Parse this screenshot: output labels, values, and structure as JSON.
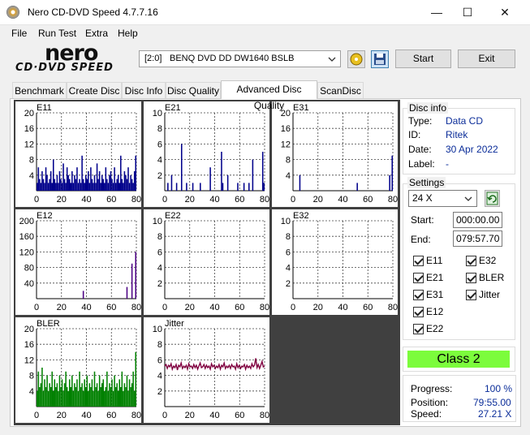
{
  "window": {
    "title": "Nero CD-DVD Speed 4.7.7.16",
    "controls": {
      "minimize": "—",
      "maximize": "☐",
      "close": "✕"
    }
  },
  "menu": [
    "File",
    "Run Test",
    "Extra",
    "Help"
  ],
  "toolbar": {
    "logo_main": "nero",
    "logo_sub": "CD·DVD SPEED",
    "drive_id": "[2:0]",
    "drive_name": "BENQ DVD DD DW1640 BSLB",
    "start_label": "Start",
    "exit_label": "Exit",
    "icons": [
      "eject-icon",
      "save-icon"
    ]
  },
  "tabs": [
    "Benchmark",
    "Create Disc",
    "Disc Info",
    "Disc Quality",
    "Advanced Disc Quality",
    "ScanDisc"
  ],
  "active_tab": "Advanced Disc Quality",
  "disc_info": {
    "title": "Disc info",
    "rows": [
      {
        "key": "Type:",
        "value": "Data CD"
      },
      {
        "key": "ID:",
        "value": "Ritek"
      },
      {
        "key": "Date:",
        "value": "30 Apr 2022"
      },
      {
        "key": "Label:",
        "value": "-"
      }
    ]
  },
  "settings": {
    "title": "Settings",
    "speed": "24 X",
    "start_label": "Start:",
    "start_value": "000:00.00",
    "end_label": "End:",
    "end_value": "079:57.70",
    "checkboxes_left": [
      "E11",
      "E21",
      "E31",
      "E12",
      "E22"
    ],
    "checkboxes_right": [
      "E32",
      "BLER",
      "Jitter"
    ]
  },
  "result": {
    "class_label": "Class 2",
    "class_color": "#7cfc3c"
  },
  "progress": {
    "rows": [
      {
        "key": "Progress:",
        "value": "100 %"
      },
      {
        "key": "Position:",
        "value": "79:55.00"
      },
      {
        "key": "Speed:",
        "value": "27.21 X"
      }
    ]
  },
  "chart_data": [
    {
      "type": "bar",
      "title": "E11",
      "ylim": [
        0,
        20
      ],
      "yticks": [
        "20",
        "16",
        "12",
        "8",
        "4"
      ],
      "xticks": [
        "0",
        "20",
        "40",
        "60",
        "80"
      ],
      "color": "#00008b",
      "values": [
        2,
        6,
        3,
        2,
        5,
        3,
        2,
        6,
        4,
        2,
        3,
        5,
        2,
        8,
        3,
        2,
        4,
        2,
        5,
        3,
        2,
        7,
        3,
        2,
        6,
        4,
        3,
        2,
        5,
        2,
        4,
        3,
        6,
        2,
        3,
        2,
        9,
        3,
        2,
        4,
        3,
        5,
        2,
        6,
        3,
        2,
        4,
        2,
        7,
        3,
        5,
        2,
        4,
        3,
        2,
        6,
        3,
        2,
        4,
        5,
        3,
        2,
        6,
        2,
        3,
        4,
        2,
        9,
        3,
        2,
        5,
        4,
        3,
        6,
        2,
        4,
        3,
        2,
        5,
        9
      ]
    },
    {
      "type": "bar",
      "title": "E21",
      "ylim": [
        0,
        10
      ],
      "yticks": [
        "10",
        "8",
        "6",
        "4",
        "2"
      ],
      "xticks": [
        "0",
        "20",
        "40",
        "60",
        "80"
      ],
      "color": "#00008b",
      "values": [
        0,
        0,
        1,
        0,
        0,
        2,
        0,
        0,
        0,
        1,
        0,
        0,
        0,
        6,
        0,
        0,
        0,
        1,
        0,
        0,
        0,
        0,
        1,
        0,
        0,
        0,
        0,
        0,
        1,
        0,
        0,
        0,
        0,
        0,
        0,
        0,
        3,
        0,
        0,
        0,
        0,
        0,
        0,
        0,
        0,
        5,
        1,
        0,
        0,
        0,
        2,
        0,
        0,
        0,
        0,
        0,
        0,
        0,
        1,
        0,
        0,
        0,
        0,
        1,
        0,
        0,
        0,
        1,
        0,
        0,
        4,
        0,
        0,
        0,
        0,
        0,
        0,
        0,
        5,
        1
      ]
    },
    {
      "type": "bar",
      "title": "E31",
      "ylim": [
        0,
        20
      ],
      "yticks": [
        "20",
        "16",
        "12",
        "8",
        "4"
      ],
      "xticks": [
        "0",
        "20",
        "40",
        "60",
        "80"
      ],
      "color": "#00008b",
      "values": [
        0,
        0,
        0,
        0,
        0,
        4,
        0,
        0,
        0,
        0,
        0,
        0,
        0,
        0,
        0,
        0,
        0,
        0,
        0,
        0,
        0,
        0,
        0,
        0,
        0,
        0,
        0,
        0,
        0,
        0,
        0,
        0,
        0,
        0,
        0,
        0,
        0,
        0,
        0,
        0,
        0,
        0,
        0,
        0,
        0,
        0,
        0,
        0,
        0,
        0,
        0,
        2,
        0,
        0,
        0,
        0,
        0,
        0,
        0,
        0,
        0,
        0,
        0,
        0,
        0,
        0,
        0,
        0,
        0,
        0,
        0,
        0,
        0,
        0,
        0,
        0,
        0,
        4,
        0,
        9
      ]
    },
    {
      "type": "bar",
      "title": "E12",
      "ylim": [
        0,
        200
      ],
      "yticks": [
        "200",
        "160",
        "120",
        "80",
        "40"
      ],
      "xticks": [
        "0",
        "20",
        "40",
        "60",
        "80"
      ],
      "color": "#4b0082",
      "values": [
        0,
        0,
        0,
        0,
        0,
        0,
        0,
        0,
        0,
        0,
        0,
        0,
        0,
        0,
        0,
        0,
        0,
        0,
        0,
        0,
        0,
        0,
        0,
        0,
        0,
        0,
        0,
        0,
        0,
        0,
        0,
        0,
        0,
        0,
        0,
        0,
        0,
        20,
        0,
        0,
        0,
        0,
        0,
        0,
        0,
        0,
        0,
        0,
        0,
        0,
        0,
        0,
        0,
        0,
        0,
        0,
        0,
        0,
        0,
        0,
        0,
        0,
        0,
        0,
        0,
        0,
        0,
        0,
        0,
        0,
        0,
        0,
        30,
        0,
        0,
        0,
        90,
        0,
        0,
        120
      ]
    },
    {
      "type": "bar",
      "title": "E22",
      "ylim": [
        0,
        10
      ],
      "yticks": [
        "10",
        "8",
        "6",
        "4",
        "2"
      ],
      "xticks": [
        "0",
        "20",
        "40",
        "60",
        "80"
      ],
      "color": "#00008b",
      "values": []
    },
    {
      "type": "bar",
      "title": "E32",
      "ylim": [
        0,
        10
      ],
      "yticks": [
        "10",
        "8",
        "6",
        "4",
        "2"
      ],
      "xticks": [
        "0",
        "20",
        "40",
        "60",
        "80"
      ],
      "color": "#00008b",
      "values": []
    },
    {
      "type": "bar",
      "title": "BLER",
      "ylim": [
        0,
        20
      ],
      "yticks": [
        "20",
        "16",
        "12",
        "8",
        "4"
      ],
      "xticks": [
        "0",
        "20",
        "40",
        "60",
        "80"
      ],
      "color": "#008000",
      "values": [
        4,
        9,
        5,
        6,
        10,
        4,
        7,
        5,
        8,
        4,
        6,
        5,
        9,
        4,
        7,
        5,
        6,
        4,
        8,
        5,
        7,
        4,
        6,
        9,
        5,
        4,
        7,
        5,
        8,
        4,
        6,
        5,
        7,
        4,
        9,
        5,
        6,
        4,
        7,
        5,
        8,
        4,
        6,
        5,
        7,
        4,
        9,
        5,
        6,
        4,
        8,
        5,
        6,
        7,
        4,
        5,
        9,
        4,
        6,
        5,
        7,
        4,
        8,
        5,
        6,
        4,
        7,
        5,
        9,
        4,
        6,
        5,
        8,
        4,
        7,
        5,
        6,
        9,
        4,
        14
      ]
    },
    {
      "type": "line",
      "title": "Jitter",
      "ylim": [
        0,
        10
      ],
      "yticks": [
        "10",
        "8",
        "6",
        "4",
        "2"
      ],
      "xticks": [
        "0",
        "20",
        "40",
        "60",
        "80"
      ],
      "color": "#800040",
      "values": [
        5.2,
        5.4,
        4.9,
        5.3,
        5.1,
        5.5,
        4.8,
        5.2,
        5.0,
        5.4,
        4.7,
        5.3,
        5.1,
        5.6,
        4.9,
        5.2,
        5.0,
        5.3,
        4.8,
        5.5,
        5.1,
        5.2,
        4.9,
        5.4,
        5.0,
        5.3,
        4.8,
        5.2,
        5.6,
        5.0,
        5.1,
        5.4,
        4.9,
        5.3,
        5.0,
        5.2,
        4.8,
        5.5,
        5.1,
        5.3,
        4.9,
        5.2,
        5.0,
        5.4,
        4.8,
        5.3,
        5.1,
        5.6,
        4.9,
        5.2,
        5.0,
        5.3,
        4.9,
        5.4,
        5.1,
        5.2,
        4.8,
        5.5,
        5.0,
        5.3,
        4.9,
        5.2,
        5.1,
        5.4,
        4.8,
        5.3,
        5.0,
        5.2,
        4.9,
        5.5,
        5.1,
        5.3,
        6.2,
        5.0,
        5.4,
        4.9,
        5.3,
        5.8,
        5.1,
        5.2
      ]
    }
  ]
}
